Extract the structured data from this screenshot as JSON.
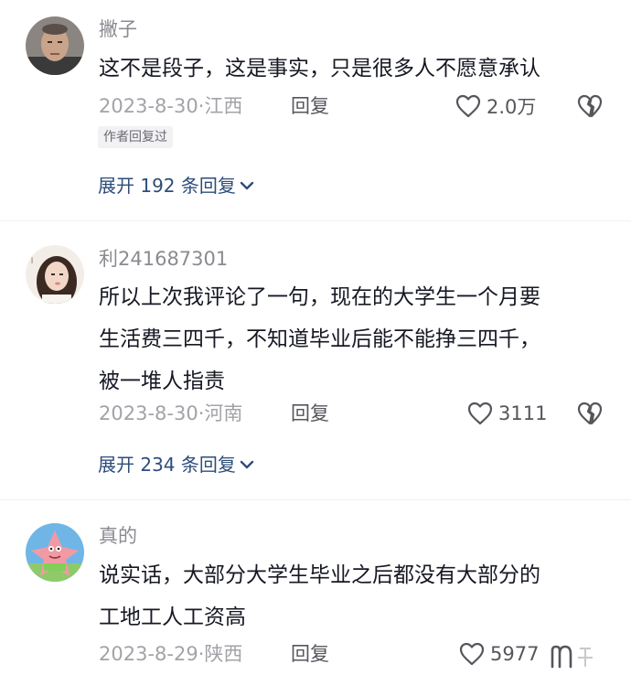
{
  "comments": [
    {
      "username": "撇子",
      "text_lines": [
        "这不是段子，这是事实，只是很多人不愿意承认"
      ],
      "date": "2023-8-30",
      "region": "江西",
      "reply_label": "回复",
      "likes": "2.0万",
      "badge": "作者回复过",
      "expand": "展开 192 条回复"
    },
    {
      "username": "利241687301",
      "text_lines": [
        "所以上次我评论了一句，现在的大学生一个月要",
        "生活费三四千，不知道毕业后能不能挣三四千，",
        "被一堆人指责"
      ],
      "date": "2023-8-30",
      "region": "河南",
      "reply_label": "回复",
      "likes": "3111",
      "expand": "展开 234 条回复"
    },
    {
      "username": "真的",
      "text_lines": [
        "说实话，大部分大学生毕业之后都没有大部分的",
        "工地工人工资高"
      ],
      "date": "2023-8-29",
      "region": "陕西",
      "reply_label": "回复",
      "likes": "5977"
    }
  ],
  "icons": {
    "like": "heart-outline-icon",
    "dislike": "broken-heart-icon",
    "expand": "chevron-down-icon"
  },
  "colors": {
    "link": "#2e4d7a",
    "meta": "#a2a3a8",
    "text": "#161823"
  }
}
